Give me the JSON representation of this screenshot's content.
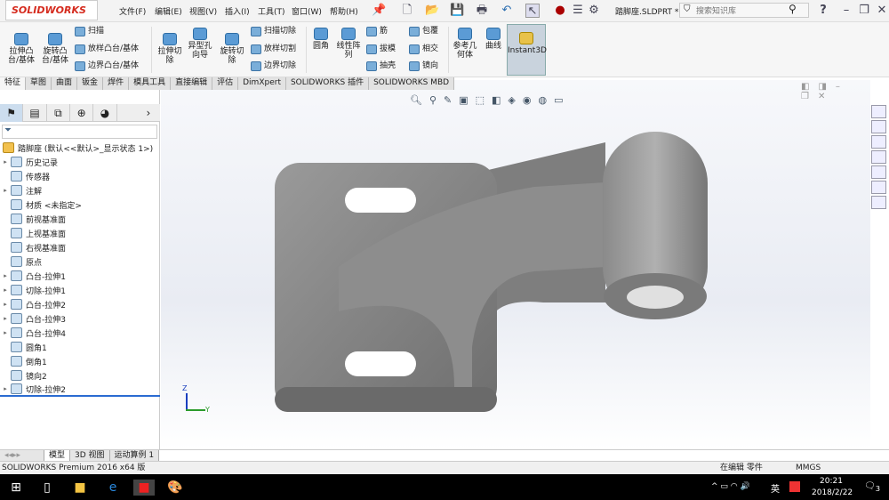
{
  "app": {
    "logo": "SOLIDWORKS",
    "doc_title": "踏脚座.SLDPRT *",
    "search_placeholder": "搜索知识库"
  },
  "menu": [
    "文件(F)",
    "编辑(E)",
    "视图(V)",
    "插入(I)",
    "工具(T)",
    "窗口(W)",
    "帮助(H)"
  ],
  "ribbon": {
    "extrude_boss": "拉伸凸台/基体",
    "revolve_boss": "旋转凸台/基体",
    "sweep": "扫描",
    "loft": "放样凸台/基体",
    "boundary": "边界凸台/基体",
    "extrude_cut": "拉伸切除",
    "hole_wizard": "异型孔向导",
    "revolve_cut": "旋转切除",
    "sweep_cut": "扫描切除",
    "loft_cut": "放样切割",
    "boundary_cut": "边界切除",
    "fillet": "圆角",
    "linear_pattern": "线性阵列",
    "rib": "筋",
    "draft": "拔模",
    "shell": "抽壳",
    "wrap": "包覆",
    "intersect": "相交",
    "mirror": "镜向",
    "ref_geometry": "参考几何体",
    "curves": "曲线",
    "instant3d": "Instant3D"
  },
  "tabs": [
    "特征",
    "草图",
    "曲面",
    "钣金",
    "焊件",
    "模具工具",
    "直接编辑",
    "评估",
    "DimXpert",
    "SOLIDWORKS 插件",
    "SOLIDWORKS MBD"
  ],
  "tree": {
    "root": "踏脚座 (默认<<默认>_显示状态 1>)",
    "items": [
      {
        "label": "历史记录",
        "exp": true
      },
      {
        "label": "传感器",
        "exp": false
      },
      {
        "label": "注解",
        "exp": true
      },
      {
        "label": "材质 <未指定>",
        "exp": false
      },
      {
        "label": "前视基准面",
        "exp": false
      },
      {
        "label": "上视基准面",
        "exp": false
      },
      {
        "label": "右视基准面",
        "exp": false
      },
      {
        "label": "原点",
        "exp": false
      },
      {
        "label": "凸台-拉伸1",
        "exp": true
      },
      {
        "label": "切除-拉伸1",
        "exp": true
      },
      {
        "label": "凸台-拉伸2",
        "exp": true
      },
      {
        "label": "凸台-拉伸3",
        "exp": true
      },
      {
        "label": "凸台-拉伸4",
        "exp": true
      },
      {
        "label": "圆角1",
        "exp": false
      },
      {
        "label": "倒角1",
        "exp": false
      },
      {
        "label": "镜向2",
        "exp": false
      },
      {
        "label": "切除-拉伸2",
        "exp": true
      }
    ]
  },
  "bottom_tabs": [
    "模型",
    "3D 视图",
    "运动算例 1"
  ],
  "status": {
    "left": "SOLIDWORKS Premium 2016 x64 版",
    "editing": "在编辑 零件",
    "units": "MMGS"
  },
  "taskbar": {
    "time": "20:21",
    "date": "2018/2/22",
    "ime": "英",
    "notifications": "3"
  },
  "axes": {
    "z": "Z",
    "y": "Y"
  }
}
